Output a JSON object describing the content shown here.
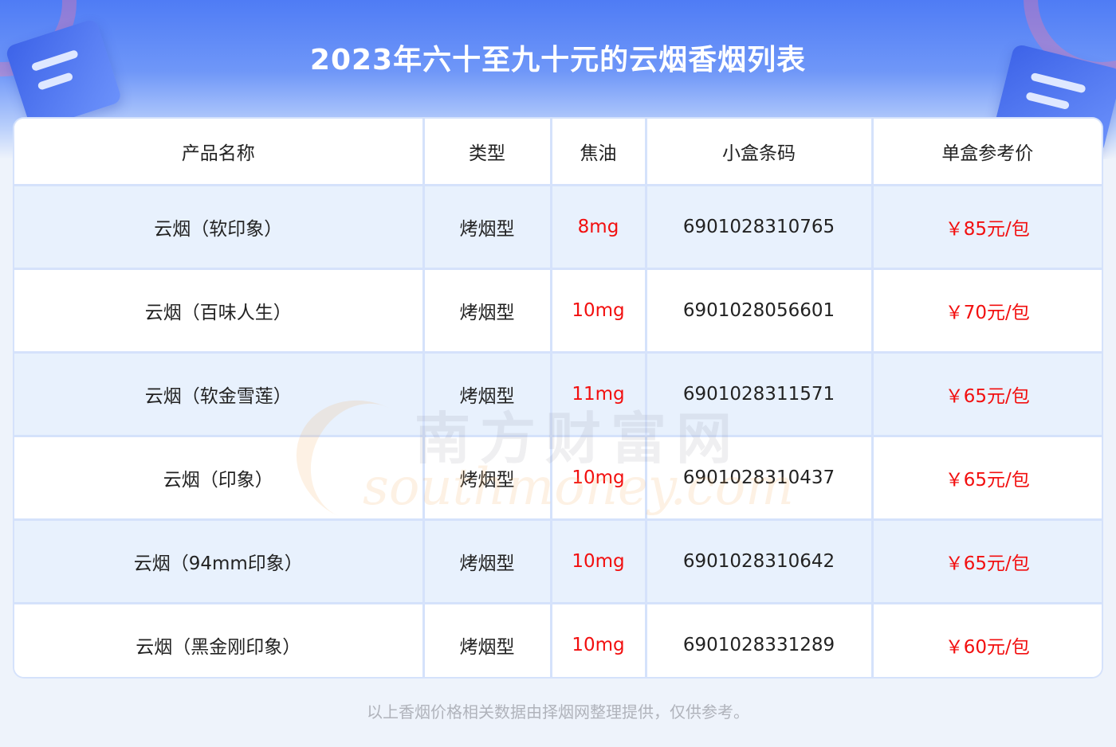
{
  "title": "2023年六十至九十元的云烟香烟列表",
  "table": {
    "headers": [
      "产品名称",
      "类型",
      "焦油",
      "小盒条码",
      "单盒参考价"
    ],
    "rows": [
      {
        "name": "云烟（软印象）",
        "type": "烤烟型",
        "tar": "8mg",
        "barcode": "6901028310765",
        "price": "￥85元/包"
      },
      {
        "name": "云烟（百味人生）",
        "type": "烤烟型",
        "tar": "10mg",
        "barcode": "6901028056601",
        "price": "￥70元/包"
      },
      {
        "name": "云烟（软金雪莲）",
        "type": "烤烟型",
        "tar": "11mg",
        "barcode": "6901028311571",
        "price": "￥65元/包"
      },
      {
        "name": "云烟（印象）",
        "type": "烤烟型",
        "tar": "10mg",
        "barcode": "6901028310437",
        "price": "￥65元/包"
      },
      {
        "name": "云烟（94mm印象）",
        "type": "烤烟型",
        "tar": "10mg",
        "barcode": "6901028310642",
        "price": "￥65元/包"
      },
      {
        "name": "云烟（黑金刚印象）",
        "type": "烤烟型",
        "tar": "10mg",
        "barcode": "6901028331289",
        "price": "￥60元/包"
      }
    ]
  },
  "watermark": {
    "cn": "南方财富网",
    "en": "southmoney.com"
  },
  "footer": "以上香烟价格相关数据由择烟网整理提供，仅供参考。",
  "colors": {
    "header_blue": "#4f7cf5",
    "price_red": "#f20f0f",
    "row_alt": "#e8f1fd",
    "border": "#d5e2fb"
  }
}
